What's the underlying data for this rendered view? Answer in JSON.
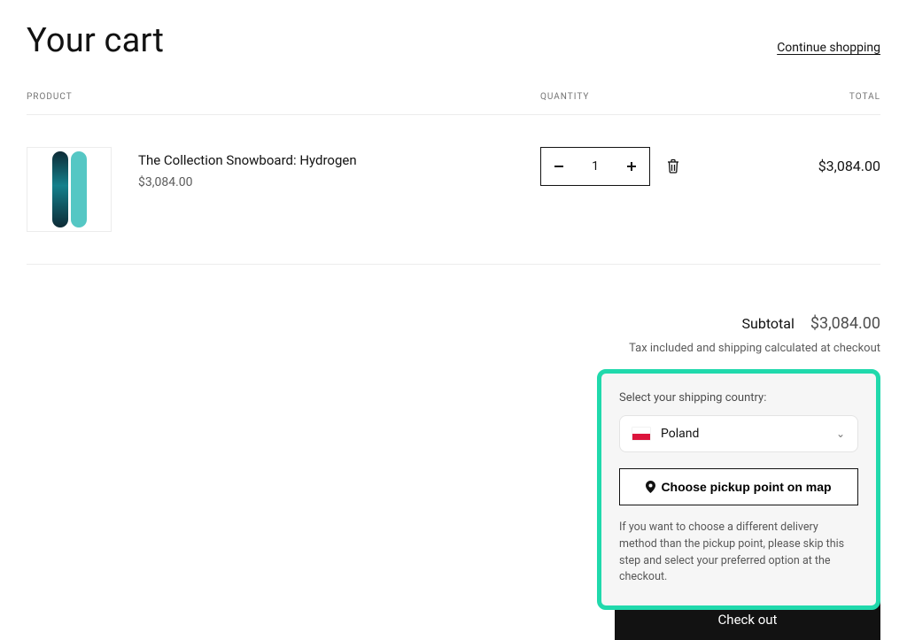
{
  "header": {
    "title": "Your cart",
    "continue_label": "Continue shopping"
  },
  "columns": {
    "product": "PRODUCT",
    "quantity": "QUANTITY",
    "total": "TOTAL"
  },
  "item": {
    "title": "The Collection Snowboard: Hydrogen",
    "price": "$3,084.00",
    "quantity": "1",
    "line_total": "$3,084.00"
  },
  "subtotal": {
    "label": "Subtotal",
    "value": "$3,084.00"
  },
  "tax_note": "Tax included and shipping calculated at checkout",
  "shipping": {
    "label": "Select your shipping country:",
    "country": "Poland",
    "pickup_label": "Choose pickup point on map",
    "note": "If you want to choose a different delivery method than the pickup point, please skip this step and select your preferred option at the checkout."
  },
  "checkout_label": "Check out"
}
